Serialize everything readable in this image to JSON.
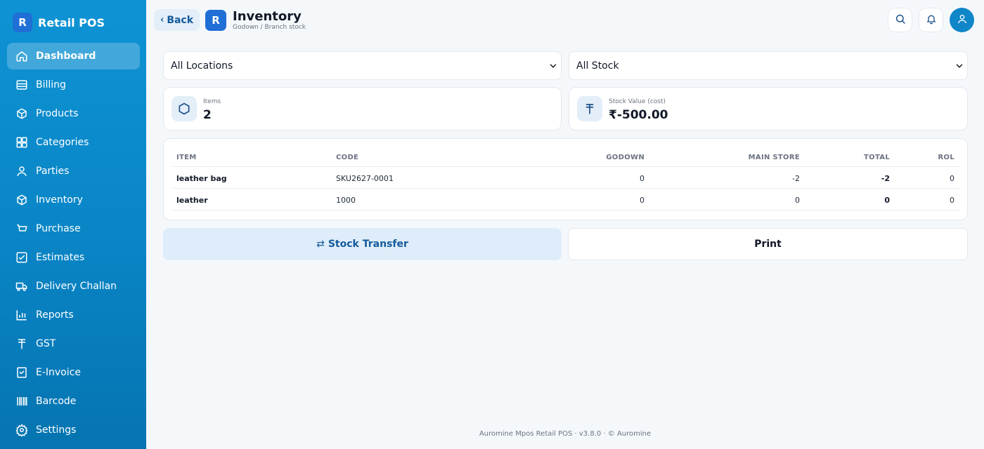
{
  "app": {
    "logo_letter": "R",
    "name": "Retail POS"
  },
  "sidebar": {
    "items": [
      {
        "label": "Dashboard",
        "icon": "home-icon",
        "active": true
      },
      {
        "label": "Billing",
        "icon": "billing-icon"
      },
      {
        "label": "Products",
        "icon": "box-icon"
      },
      {
        "label": "Categories",
        "icon": "grid-icon"
      },
      {
        "label": "Parties",
        "icon": "user-icon"
      },
      {
        "label": "Inventory",
        "icon": "package-icon"
      },
      {
        "label": "Purchase",
        "icon": "cart-icon"
      },
      {
        "label": "Estimates",
        "icon": "checklist-icon"
      },
      {
        "label": "Delivery Challan",
        "icon": "truck-icon"
      },
      {
        "label": "Reports",
        "icon": "chart-icon"
      },
      {
        "label": "GST",
        "icon": "rupee-icon"
      },
      {
        "label": "E-Invoice",
        "icon": "invoice-icon"
      },
      {
        "label": "Barcode",
        "icon": "barcode-icon"
      },
      {
        "label": "Settings",
        "icon": "gear-icon"
      }
    ]
  },
  "header": {
    "back_label": "Back",
    "logo_letter": "R",
    "title": "Inventory",
    "subtitle": "Godown / Branch stock"
  },
  "filters": {
    "location_selected": "All Locations",
    "stock_selected": "All Stock"
  },
  "stats": {
    "items_label": "Items",
    "items_value": "2",
    "stock_value_label": "Stock Value (cost)",
    "stock_value": "₹-500.00"
  },
  "table": {
    "headers": [
      "ITEM",
      "CODE",
      "GODOWN",
      "MAIN STORE",
      "TOTAL",
      "ROL"
    ],
    "rows": [
      {
        "item": "leather bag",
        "code": "SKU2627-0001",
        "godown": "0",
        "main_store": "-2",
        "total": "-2",
        "rol": "0"
      },
      {
        "item": "leather",
        "code": "1000",
        "godown": "0",
        "main_store": "0",
        "total": "0",
        "rol": "0"
      }
    ]
  },
  "actions": {
    "transfer_icon": "⇄",
    "transfer_label": "Stock Transfer",
    "print_label": "Print"
  },
  "footer": {
    "text": "Auromine Mpos Retail POS · v3.8.0 · © Auromine"
  },
  "colors": {
    "sidebar": "#0a86c7",
    "accent": "#1f6fd6",
    "background": "#f5f8fb"
  }
}
